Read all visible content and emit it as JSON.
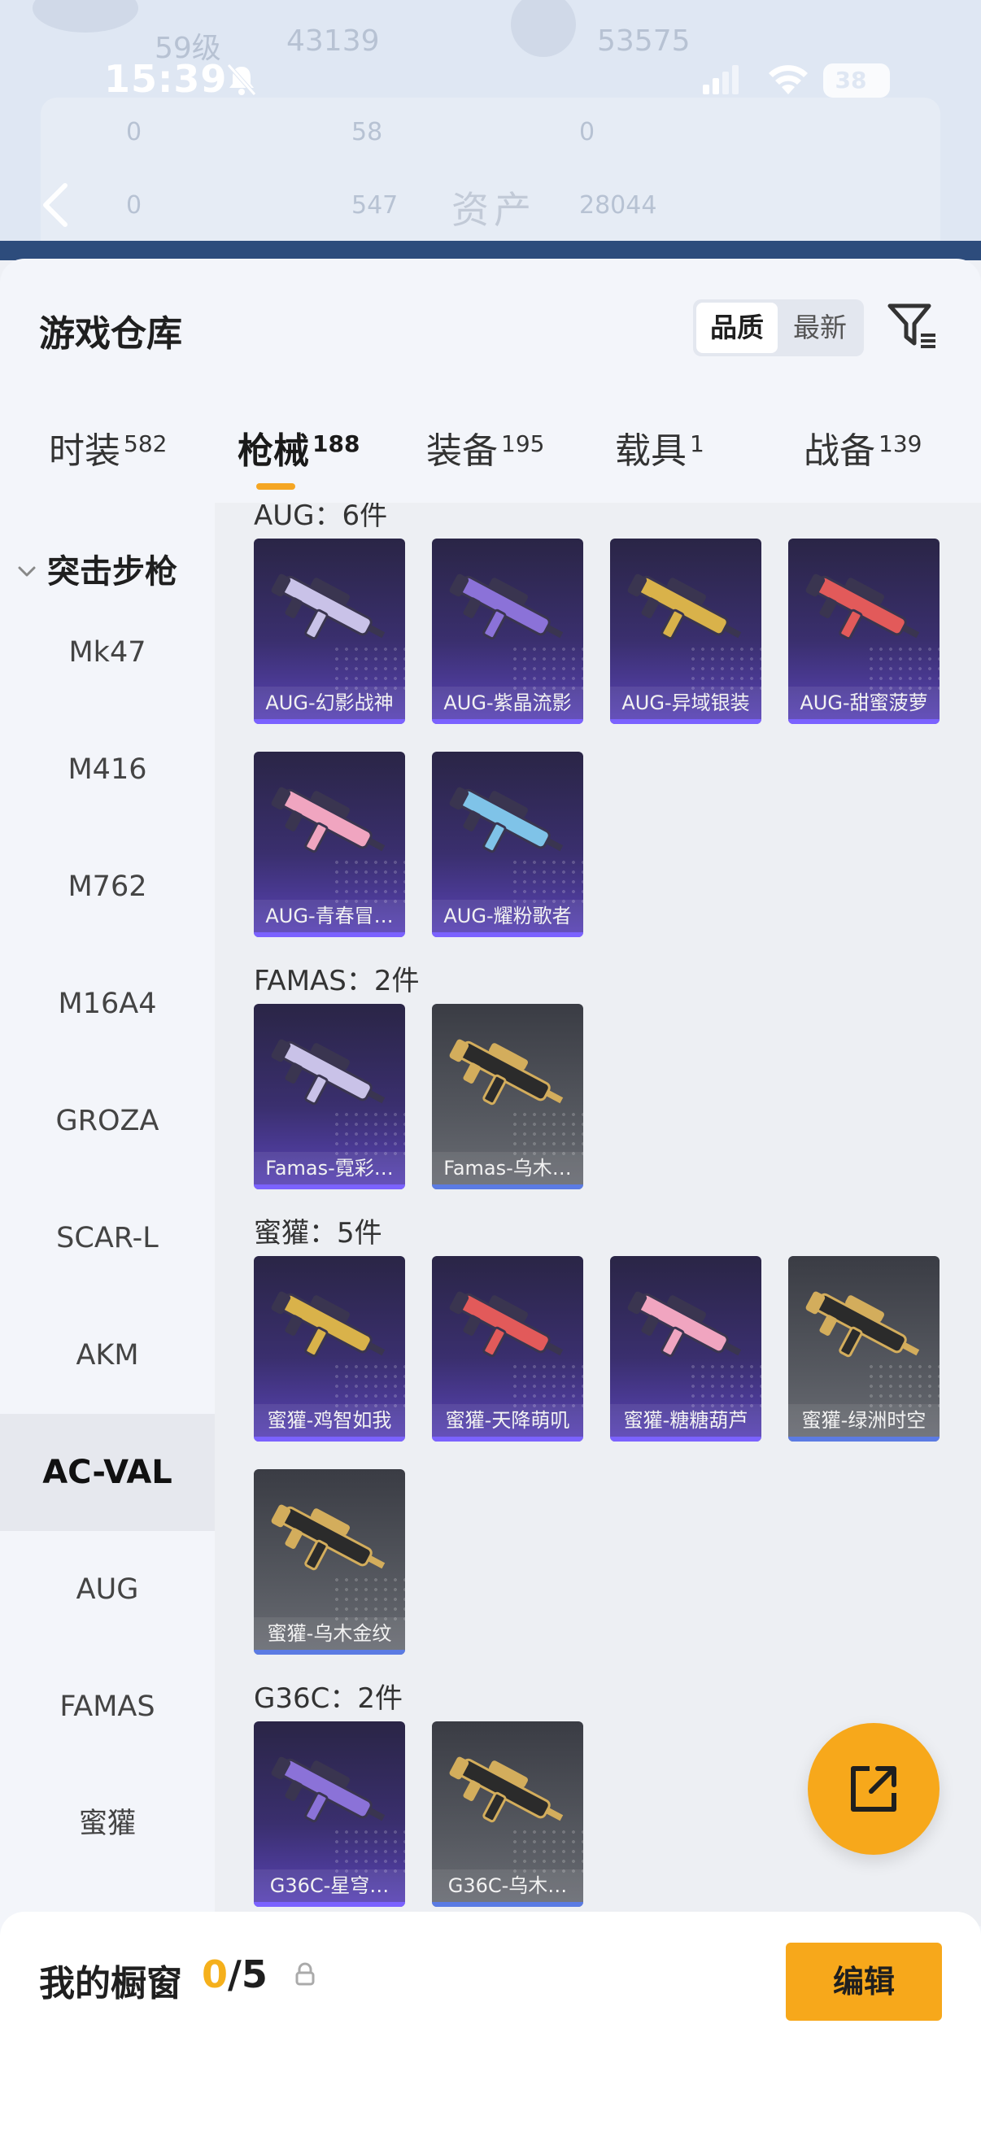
{
  "status_bar": {
    "time": "15:39",
    "battery": "38"
  },
  "background_header": {
    "title": "资产",
    "stats_top": [
      "59级",
      "43139",
      "53575"
    ],
    "stats_row1": [
      "0",
      "58",
      "0"
    ],
    "stats_row2": [
      "0",
      "547",
      "28044"
    ]
  },
  "header": {
    "title": "游戏仓库",
    "sort_options": [
      "品质",
      "最新"
    ],
    "active_sort": "品质"
  },
  "tabs": [
    {
      "label": "时装",
      "count": "582"
    },
    {
      "label": "枪械",
      "count": "188"
    },
    {
      "label": "装备",
      "count": "195"
    },
    {
      "label": "载具",
      "count": "1"
    },
    {
      "label": "战备",
      "count": "139"
    }
  ],
  "active_tab": "枪械",
  "sidebar": {
    "category": "突击步枪",
    "items": [
      "Mk47",
      "M416",
      "M762",
      "M16A4",
      "GROZA",
      "SCAR-L",
      "AKM",
      "AC-VAL",
      "AUG",
      "FAMAS",
      "蜜獾"
    ],
    "active_item": "AC-VAL"
  },
  "groups": [
    {
      "title": "AUG：6件",
      "items": [
        {
          "name": "AUG-幻影战神",
          "rarity": "purple"
        },
        {
          "name": "AUG-紫晶流影",
          "rarity": "purple"
        },
        {
          "name": "AUG-异域银装",
          "rarity": "purple"
        },
        {
          "name": "AUG-甜蜜菠萝",
          "rarity": "purple"
        },
        {
          "name": "AUG-青春冒…",
          "rarity": "purple"
        },
        {
          "name": "AUG-耀粉歌者",
          "rarity": "purple"
        }
      ]
    },
    {
      "title": "FAMAS：2件",
      "items": [
        {
          "name": "Famas-霓彩…",
          "rarity": "purple"
        },
        {
          "name": "Famas-乌木…",
          "rarity": "gray"
        }
      ]
    },
    {
      "title": "蜜獾：5件",
      "items": [
        {
          "name": "蜜獾-鸡智如我",
          "rarity": "purple"
        },
        {
          "name": "蜜獾-天降萌叽",
          "rarity": "purple"
        },
        {
          "name": "蜜獾-糖糖葫芦",
          "rarity": "purple"
        },
        {
          "name": "蜜獾-绿洲时空",
          "rarity": "gray"
        },
        {
          "name": "蜜獾-乌木金纹",
          "rarity": "gray"
        }
      ]
    },
    {
      "title": "G36C：2件",
      "items": [
        {
          "name": "G36C-星穹…",
          "rarity": "purple"
        },
        {
          "name": "G36C-乌木…",
          "rarity": "gray"
        }
      ]
    }
  ],
  "showcase": {
    "title": "我的橱窗",
    "current": "0",
    "slash": "/",
    "max": "5",
    "edit_label": "编辑"
  },
  "colors": {
    "accent": "#f7a81b",
    "purple_card": "#3a2f6e",
    "gray_card": "#55585f"
  }
}
